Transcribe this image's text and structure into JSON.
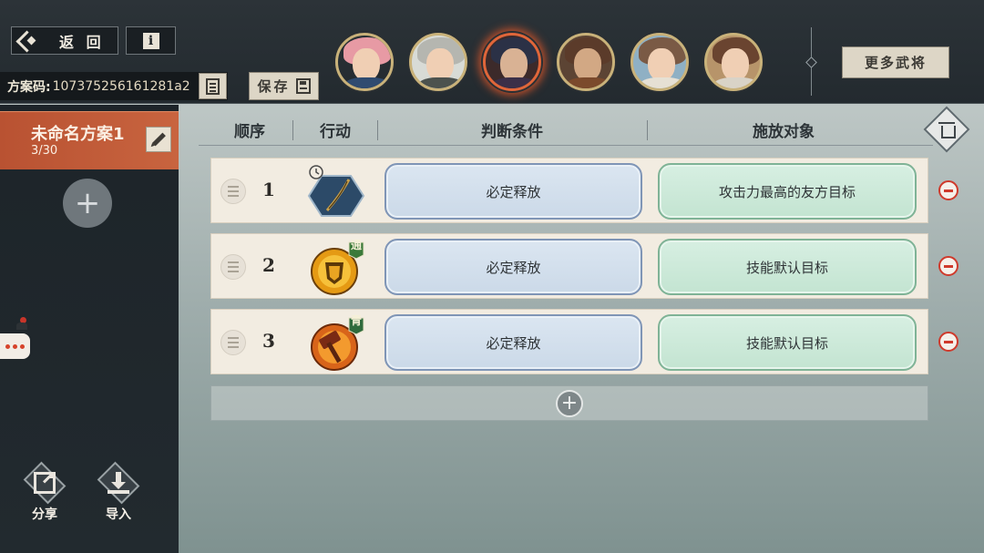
{
  "header": {
    "back_label": "返 回",
    "info_glyph": "i",
    "code_label": "方案码:",
    "code_value": "107375256161281a2",
    "save_label": "保存",
    "more_label": "更多武将"
  },
  "heroes": [
    {
      "name": "hero-1",
      "hair": "#e79aa4",
      "body": "#2f4b70",
      "selected": false
    },
    {
      "name": "hero-2",
      "hair": "#b5b6b0",
      "body": "#4c524e",
      "selected": false
    },
    {
      "name": "hero-3",
      "hair": "#2b3146",
      "body": "#3b2f48",
      "selected": true
    },
    {
      "name": "hero-4",
      "hair": "#5b3b2a",
      "body": "#7b4a2c",
      "selected": false
    },
    {
      "name": "hero-5",
      "hair": "#7a5a45",
      "body": "#e6e0d4",
      "selected": false
    },
    {
      "name": "hero-6",
      "hair": "#6a4430",
      "body": "#d9d3c7",
      "selected": false
    }
  ],
  "plan": {
    "name": "未命名方案1",
    "count": "3/30"
  },
  "side_actions": {
    "share_label": "分享",
    "import_label": "导入"
  },
  "table": {
    "headers": [
      "顺序",
      "行动",
      "判断条件",
      "施放对象"
    ],
    "rows": [
      {
        "order": "1",
        "skill": "weapon-skill-icon",
        "condition": "必定释放",
        "target": "攻击力最高的友方目标",
        "badge": ""
      },
      {
        "order": "2",
        "skill": "shield-skill-icon",
        "condition": "必定释放",
        "target": "技能默认目标",
        "badge": "通"
      },
      {
        "order": "3",
        "skill": "hammer-skill-icon",
        "condition": "必定释放",
        "target": "技能默认目标",
        "badge": "青"
      }
    ]
  },
  "colors": {
    "accent": "#c25a36",
    "condition": "#cbd9e8",
    "target": "#c3e4d1",
    "remove": "#cf3a2c"
  }
}
